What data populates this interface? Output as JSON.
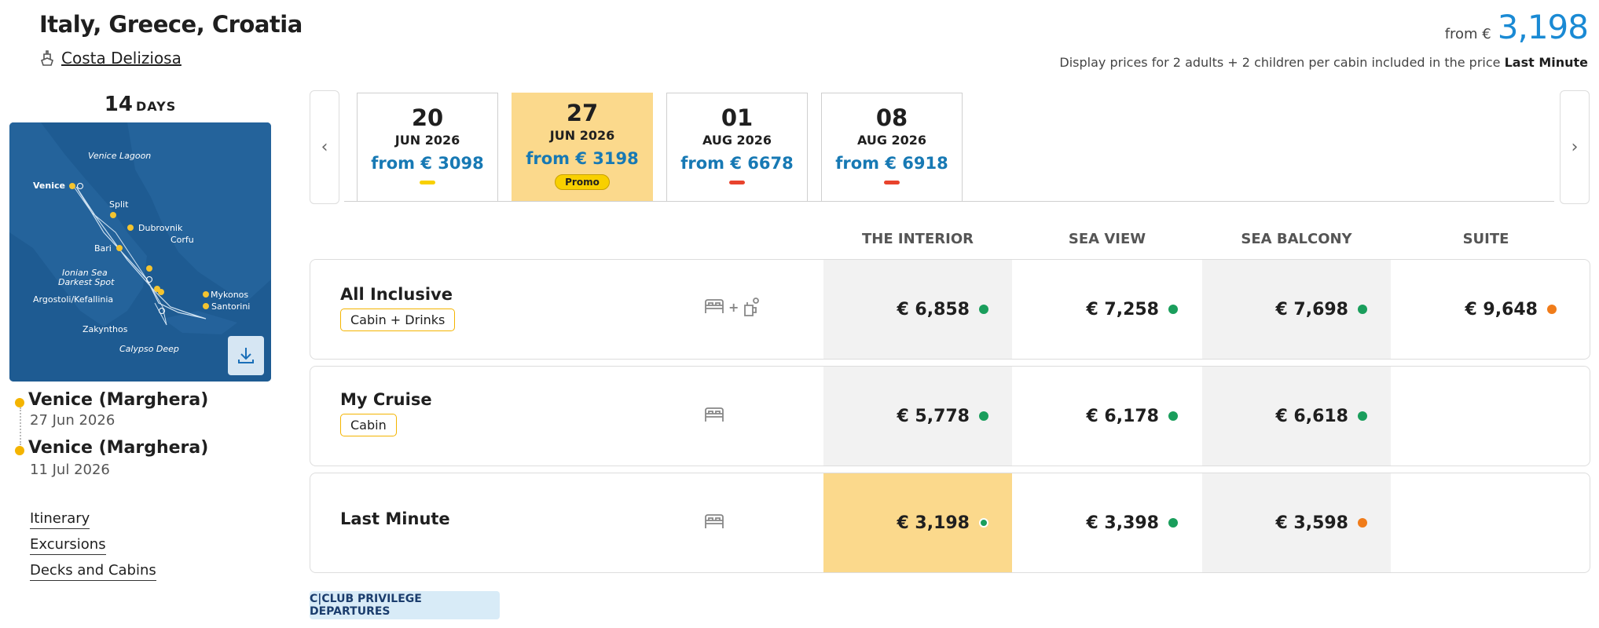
{
  "header": {
    "title": "Italy, Greece, Croatia",
    "ship": "Costa Deliziosa",
    "price_from_label": "from €",
    "price_value": "3,198",
    "disclaimer": "Display prices for 2 adults + 2 children per cabin included in the price",
    "disclaimer_bold": "Last Minute"
  },
  "trip": {
    "days_num": "14",
    "days_label": "DAYS",
    "map_labels": [
      "Venice Lagoon",
      "Venice",
      "Split",
      "Dubrovnik",
      "Corfu",
      "Bari",
      "Ionian Sea",
      "Darkest Spot",
      "Argostoli/Kefallinia",
      "Mykonos",
      "Santorini",
      "Zakynthos",
      "Calypso Deep"
    ],
    "depart_port": "Venice (Marghera)",
    "depart_date": "27 Jun 2026",
    "arrive_port": "Venice (Marghera)",
    "arrive_date": "11 Jul 2026"
  },
  "links": [
    "Itinerary",
    "Excursions",
    "Decks and Cabins"
  ],
  "dates": [
    {
      "day": "20",
      "month_year": "JUN 2026",
      "price": "from € 3098",
      "bar_color": "#f8d000"
    },
    {
      "day": "27",
      "month_year": "JUN 2026",
      "price": "from € 3198",
      "badge": "Promo"
    },
    {
      "day": "01",
      "month_year": "AUG 2026",
      "price": "from € 6678",
      "bar_color": "#e8432d"
    },
    {
      "day": "08",
      "month_year": "AUG 2026",
      "price": "from € 6918",
      "bar_color": "#e8432d"
    }
  ],
  "columns": [
    "THE INTERIOR",
    "SEA VIEW",
    "SEA BALCONY",
    "SUITE"
  ],
  "rows": [
    {
      "name": "All Inclusive",
      "tag": "Cabin + Drinks",
      "icon": "bed-plus-drinks-icon",
      "plus": "+",
      "prices": [
        "€ 6,858",
        "€ 7,258",
        "€ 7,698",
        "€ 9,648"
      ],
      "dots": [
        "#1a9e5c",
        "#1a9e5c",
        "#1a9e5c",
        "#f07c1a"
      ]
    },
    {
      "name": "My Cruise",
      "tag": "Cabin",
      "icon": "bed-icon",
      "prices": [
        "€ 5,778",
        "€ 6,178",
        "€ 6,618"
      ],
      "dots": [
        "#1a9e5c",
        "#1a9e5c",
        "#1a9e5c"
      ]
    },
    {
      "name": "Last Minute",
      "icon": "bed-icon",
      "prices": [
        "€ 3,198",
        "€ 3,398",
        "€ 3,598"
      ],
      "dots": [
        "#1a9e5c",
        "#1a9e5c",
        "#f07c1a"
      ]
    }
  ],
  "cclub_label": "C|CLUB PRIVILEGE DEPARTURES",
  "colors": {
    "accent_blue": "#1a8ad4",
    "highlight": "#fbd98c",
    "available": "#1a9e5c",
    "limited": "#f07c1a"
  }
}
